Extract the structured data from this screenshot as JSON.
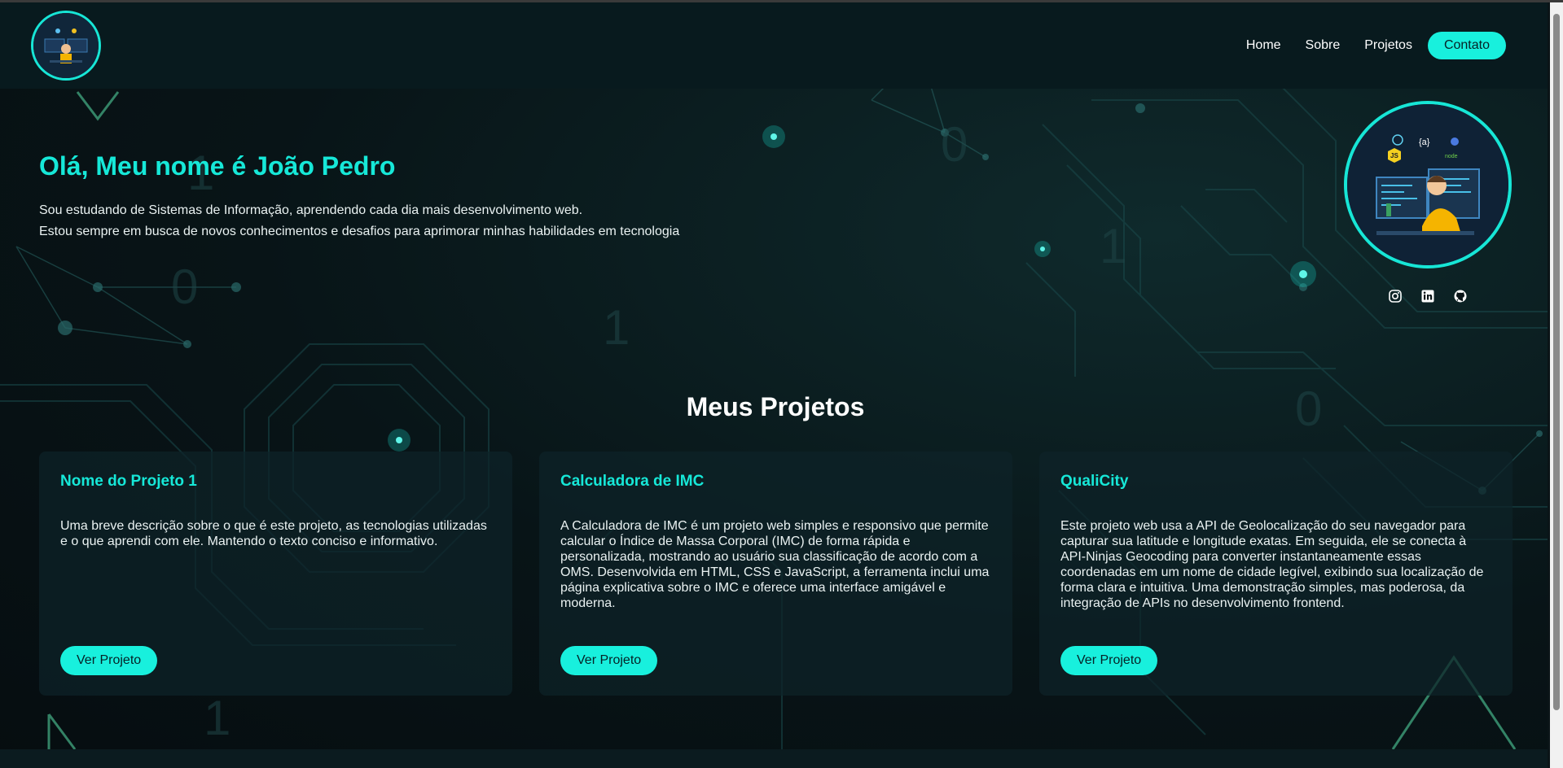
{
  "nav": {
    "items": [
      {
        "label": "Home"
      },
      {
        "label": "Sobre"
      },
      {
        "label": "Projetos"
      }
    ],
    "cta_label": "Contato"
  },
  "hero": {
    "title": "Olá, Meu nome é João Pedro",
    "line1": "Sou estudando de Sistemas de Informação, aprendendo cada dia mais desenvolvimento web.",
    "line2": "Estou sempre em busca de novos conhecimentos e desafios para aprimorar minhas habilidades em tecnologia"
  },
  "avatar_badges": {
    "js": "JS",
    "braces": "{a}",
    "node": "node"
  },
  "socials": [
    "instagram-icon",
    "linkedin-icon",
    "github-icon"
  ],
  "projects": {
    "section_title": "Meus Projetos",
    "cards": [
      {
        "title": "Nome do Projeto 1",
        "description": "Uma breve descrição sobre o que é este projeto, as tecnologias utilizadas e o que aprendi com ele. Mantendo o texto conciso e informativo.",
        "button": "Ver Projeto"
      },
      {
        "title": "Calculadora de IMC",
        "description": "A Calculadora de IMC é um projeto web simples e responsivo que permite calcular o Índice de Massa Corporal (IMC) de forma rápida e personalizada, mostrando ao usuário sua classificação de acordo com a OMS. Desenvolvida em HTML, CSS e JavaScript, a ferramenta inclui uma página explicativa sobre o IMC e oferece uma interface amigável e moderna.",
        "button": "Ver Projeto"
      },
      {
        "title": "QualiCity",
        "description": "Este projeto web usa a API de Geolocalização do seu navegador para capturar sua latitude e longitude exatas. Em seguida, ele se conecta à API-Ninjas Geocoding para converter instantaneamente essas coordenadas em um nome de cidade legível, exibindo sua localização de forma clara e intuitiva. Uma demonstração simples, mas poderosa, da integração de APIs no desenvolvimento frontend.",
        "button": "Ver Projeto"
      }
    ]
  },
  "colors": {
    "accent": "#17e6d6",
    "background": "#0a1417",
    "header": "#081a1e"
  }
}
